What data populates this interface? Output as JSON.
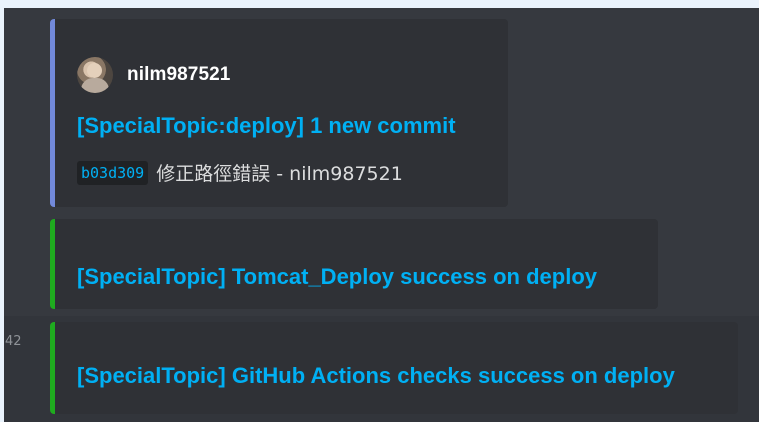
{
  "messages": [
    {
      "type": "commit-embed",
      "author": "nilm987521",
      "title": "[SpecialTopic:deploy] 1 new commit",
      "commit": {
        "hash": "b03d309",
        "message": "修正路徑錯誤 - nilm987521"
      },
      "bar_color": "#7289da"
    },
    {
      "type": "status-embed",
      "title": "[SpecialTopic] Tomcat_Deploy success on deploy",
      "bar_color": "#1fab1f"
    },
    {
      "type": "status-embed",
      "timestamp": "42",
      "title": "[SpecialTopic] GitHub Actions checks success on deploy",
      "bar_color": "#1fab1f"
    }
  ],
  "icons": {
    "avatar": "user-avatar"
  },
  "colors": {
    "background": "#36393f",
    "embed_background": "#2f3136",
    "link": "#00b0f4",
    "text": "#dcddde"
  }
}
